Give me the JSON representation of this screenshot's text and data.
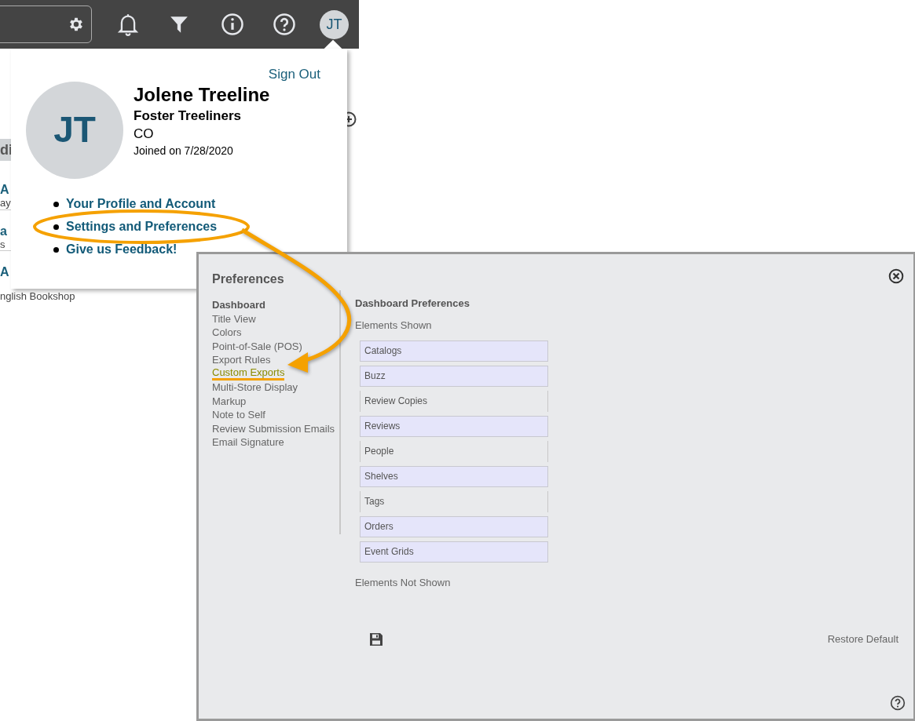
{
  "top_bar": {
    "avatar_initials": "JT"
  },
  "background_list": {
    "heading": "di",
    "rows": [
      {
        "title": "A",
        "subtitle": "ay"
      },
      {
        "title": "a",
        "subtitle": "s"
      },
      {
        "title": "A",
        "subtitle": "nglish Bookshop"
      }
    ]
  },
  "profile_menu": {
    "sign_out": "Sign Out",
    "initials": "JT",
    "name": "Jolene Treeline",
    "company": "Foster Treeliners",
    "region": "CO",
    "joined": "Joined on 7/28/2020",
    "links": [
      {
        "label": "Your Profile and Account",
        "circled": false
      },
      {
        "label": "Settings and Preferences",
        "circled": true
      },
      {
        "label": "Give us Feedback!",
        "circled": false
      }
    ]
  },
  "preferences": {
    "title": "Preferences",
    "nav": [
      {
        "label": "Dashboard",
        "selected": true,
        "annotated": false
      },
      {
        "label": "Title View",
        "selected": false,
        "annotated": false
      },
      {
        "label": "Colors",
        "selected": false,
        "annotated": false
      },
      {
        "label": "Point-of-Sale (POS)",
        "selected": false,
        "annotated": false
      },
      {
        "label": "Export Rules",
        "selected": false,
        "annotated": false
      },
      {
        "label": "Custom Exports",
        "selected": false,
        "annotated": true
      },
      {
        "label": "Multi-Store Display",
        "selected": false,
        "annotated": false
      },
      {
        "label": "Markup",
        "selected": false,
        "annotated": false
      },
      {
        "label": "Note to Self",
        "selected": false,
        "annotated": false
      },
      {
        "label": "Review Submission Emails",
        "selected": false,
        "annotated": false
      },
      {
        "label": "Email Signature",
        "selected": false,
        "annotated": false
      }
    ],
    "section_title": "Dashboard Preferences",
    "shown_label": "Elements Shown",
    "shown": [
      {
        "label": "Catalogs",
        "filled": true
      },
      {
        "label": "Buzz",
        "filled": true
      },
      {
        "label": "Review Copies",
        "filled": false
      },
      {
        "label": "Reviews",
        "filled": true
      },
      {
        "label": "People",
        "filled": false
      },
      {
        "label": "Shelves",
        "filled": true
      },
      {
        "label": "Tags",
        "filled": false
      },
      {
        "label": "Orders",
        "filled": true
      },
      {
        "label": "Event Grids",
        "filled": true
      }
    ],
    "not_shown_label": "Elements Not Shown",
    "restore": "Restore Default"
  }
}
